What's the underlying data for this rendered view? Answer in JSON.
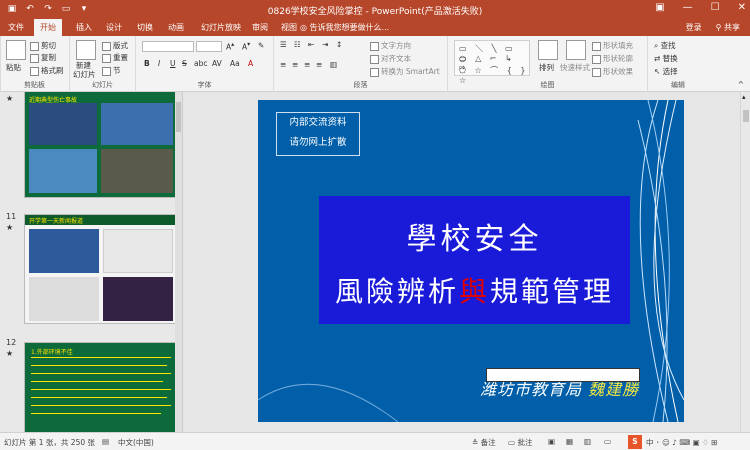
{
  "titlebar": {
    "title": "0826学校安全风险掌控 - PowerPoint(产品激活失败)",
    "restore_icon": "restore-icon",
    "minimize": "—",
    "maximize": "☐",
    "close": "✕"
  },
  "tabs": [
    "文件",
    "开始",
    "插入",
    "设计",
    "切换",
    "动画",
    "幻灯片放映",
    "审阅",
    "视图"
  ],
  "tell_me": "告诉我您想要做什么...",
  "account": {
    "login": "登录",
    "share": "共享"
  },
  "ribbon": {
    "clipboard": {
      "paste": "粘贴",
      "cut": "剪切",
      "copy": "复制",
      "format_painter": "格式刷",
      "label": "剪贴板"
    },
    "slides": {
      "new_slide": "新建",
      "new_slide2": "幻灯片",
      "layout": "版式",
      "reset": "重置",
      "section": "节",
      "label": "幻灯片"
    },
    "font": {
      "label": "字体",
      "bold": "B",
      "italic": "I",
      "underline": "U",
      "strike": "S",
      "shadow": "abc",
      "spacing": "AV",
      "case": "Aa",
      "color": "A"
    },
    "paragraph": {
      "text_direction": "文字方向",
      "align_text": "对齐文本",
      "smartart": "转换为 SmartArt",
      "label": "段落"
    },
    "drawing": {
      "arrange": "排列",
      "quick_styles": "快速样式",
      "shape_fill": "形状填充",
      "shape_outline": "形状轮廓",
      "shape_effects": "形状效果",
      "label": "绘图"
    },
    "editing": {
      "find": "查找",
      "replace": "替换",
      "select": "选择",
      "label": "编辑"
    }
  },
  "thumbnails": [
    {
      "number": "",
      "caption": "近期典型伤亡事故"
    },
    {
      "number": "11",
      "caption": "开学第一天新闻报道"
    },
    {
      "number": "12",
      "caption": "1.外部环境不佳"
    }
  ],
  "slide": {
    "notice_line1": "内部交流资料",
    "notice_line2": "请勿网上扩散",
    "title_line1": "學校安全",
    "title_line2a": "風險辨析",
    "title_line2b": "與",
    "title_line2c": "規範管理",
    "bottom_text": "潍坊市教育局",
    "bottom_name": "魏建勝"
  },
  "status": {
    "slide_info": "幻灯片 第 1 张，共 250 张",
    "language": "中文(中国)",
    "notes": "备注",
    "comments": "批注"
  },
  "colors": {
    "accent": "#b7472a",
    "slide_bg": "#005fa8",
    "title_box": "#1a1ad9",
    "highlight": "#e00000"
  }
}
